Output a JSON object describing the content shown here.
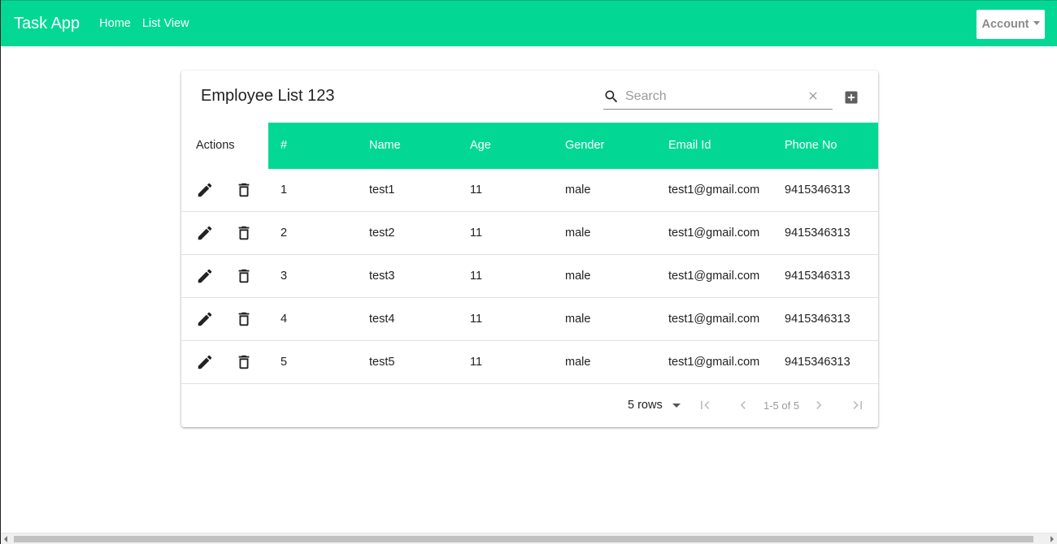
{
  "navbar": {
    "brand": "Task App",
    "links": [
      "Home",
      "List View"
    ],
    "account_label": "Account"
  },
  "card": {
    "title": "Employee List 123",
    "search_placeholder": "Search"
  },
  "table": {
    "columns": [
      "Actions",
      "#",
      "Name",
      "Age",
      "Gender",
      "Email Id",
      "Phone No"
    ],
    "rows": [
      {
        "id": "1",
        "name": "test1",
        "age": "11",
        "gender": "male",
        "email": "test1@gmail.com",
        "phone": "9415346313"
      },
      {
        "id": "2",
        "name": "test2",
        "age": "11",
        "gender": "male",
        "email": "test1@gmail.com",
        "phone": "9415346313"
      },
      {
        "id": "3",
        "name": "test3",
        "age": "11",
        "gender": "male",
        "email": "test1@gmail.com",
        "phone": "9415346313"
      },
      {
        "id": "4",
        "name": "test4",
        "age": "11",
        "gender": "male",
        "email": "test1@gmail.com",
        "phone": "9415346313"
      },
      {
        "id": "5",
        "name": "test5",
        "age": "11",
        "gender": "male",
        "email": "test1@gmail.com",
        "phone": "9415346313"
      }
    ]
  },
  "pagination": {
    "rows_per_page": "5 rows",
    "range_text": "1-5 of 5"
  },
  "colors": {
    "accent": "#02d893",
    "icon_dark": "#222222",
    "muted": "#9a9a9a"
  },
  "icons": {
    "search": "search-icon",
    "clear": "close-icon",
    "add": "add-box-icon",
    "edit": "pencil-icon",
    "delete": "trash-icon",
    "first": "first-page-icon",
    "prev": "chevron-left-icon",
    "next": "chevron-right-icon",
    "last": "last-page-icon"
  }
}
